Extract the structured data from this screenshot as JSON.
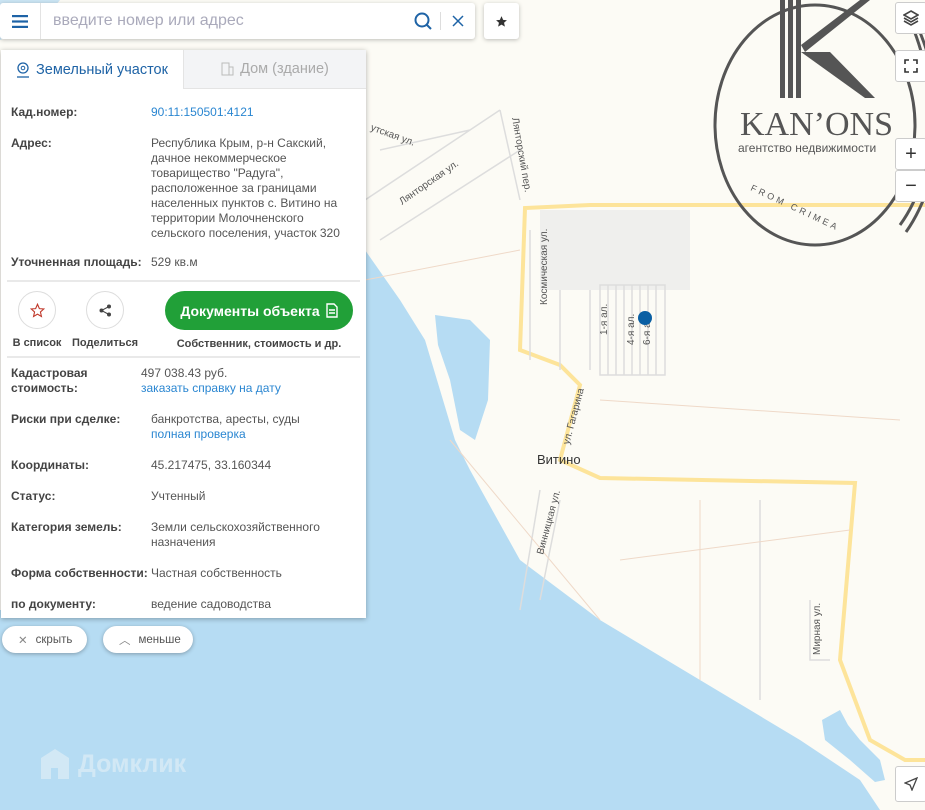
{
  "search": {
    "placeholder": "введите номер или адрес"
  },
  "tabs": [
    {
      "label": "Земельный участок",
      "active": true
    },
    {
      "label": "Дом (здание)",
      "active": false
    }
  ],
  "info": {
    "cad_number": {
      "label": "Кад.номер:",
      "value": "90:11:150501:4121"
    },
    "address": {
      "label": "Адрес:",
      "value": "Республика Крым, р-н Сакский, дачное некоммерческое товарищество \"Радуга\", расположенное за границами населенных пунктов с. Витино на территории Молочненского сельского поселения, участок 320"
    },
    "area": {
      "label": "Уточненная площадь:",
      "value": "529 кв.м"
    }
  },
  "actions": {
    "add_to_list": "В список",
    "share": "Поделиться",
    "documents": "Документы объекта",
    "documents_sub": "Собственник, стоимость и др."
  },
  "details": [
    {
      "label": "Кадастровая стоимость:",
      "value": "497 038.43 руб.",
      "link": "заказать справку на дату"
    },
    {
      "label": "Риски при сделке:",
      "value": "банкротства, аресты, суды",
      "link": "полная проверка"
    },
    {
      "label": "Координаты:",
      "value": "45.217475, 33.160344"
    },
    {
      "label": "Статус:",
      "value": "Учтенный"
    },
    {
      "label": "Категория земель:",
      "value": "Земли сельскохозяйственного назначения"
    },
    {
      "label": "Форма собственности:",
      "value": "Частная собственность"
    },
    {
      "label": "по документу:",
      "value": "ведение садоводства"
    }
  ],
  "buttons": {
    "hide": "скрыть",
    "less": "меньше"
  },
  "map": {
    "labels": {
      "street1": "утская ул.",
      "street2": "Лянторская ул.",
      "street3": "Лянторский пер.",
      "street4": "Космическая ул.",
      "alley1": "1-я ал.",
      "alley4": "4-я ал.",
      "alley6": "6-я ал.",
      "gagarina": "ул. Гагарина",
      "village": "Витино",
      "vinnitska": "Винницкая ул.",
      "mirnaya": "Мирная ул."
    },
    "colors": {
      "sea": "#b6dcf3",
      "land": "#fcfbf5",
      "road": "#fde49a",
      "marker": "#0a5fa3"
    }
  },
  "logos": {
    "domclick": "Домклик",
    "kanons": "KAN’ONS",
    "kanons_sub": "агентство недвижимости",
    "kanons_tag": "FROM CRIMEA"
  }
}
